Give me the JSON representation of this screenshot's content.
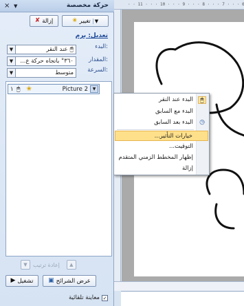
{
  "pane": {
    "title": "حركة مخصصة",
    "add_effect_label": "تغيير",
    "remove_label": "إزالة",
    "edit_label": "تعديل: برم",
    "start_label": "البدء:",
    "start_value": "عند النقر",
    "amount_label": "المقدار:",
    "amount_value": "٣٦٠° باتجاه حركة ع...",
    "speed_label": "السرعة:",
    "speed_value": "متوسط",
    "list_item": {
      "number": "١",
      "name": "Picture 2"
    },
    "reorder_label": "إعادة ترتيب",
    "play_label": "تشغيل",
    "slideshow_label": "عرض الشرائح",
    "auto_preview_label": "معاينة تلقائية"
  },
  "ruler": {
    "top_marks": "· · 11 · · · 10 · · · 9 · · · 8 · · · 7 · · · 6 · · ·"
  },
  "context_menu": {
    "items": [
      {
        "label": "البدء عند النقر",
        "icon": "mouse-icon"
      },
      {
        "label": "البدء مع السابق",
        "icon": ""
      },
      {
        "label": "البدء بعد السابق",
        "icon": "clock-icon"
      },
      {
        "label": "خيارات التأثير...",
        "icon": ""
      },
      {
        "label": "التوقيت...",
        "icon": ""
      },
      {
        "label": "إظهار المخطط الزمني المتقدم",
        "icon": ""
      },
      {
        "label": "إزالة",
        "icon": ""
      }
    ]
  }
}
